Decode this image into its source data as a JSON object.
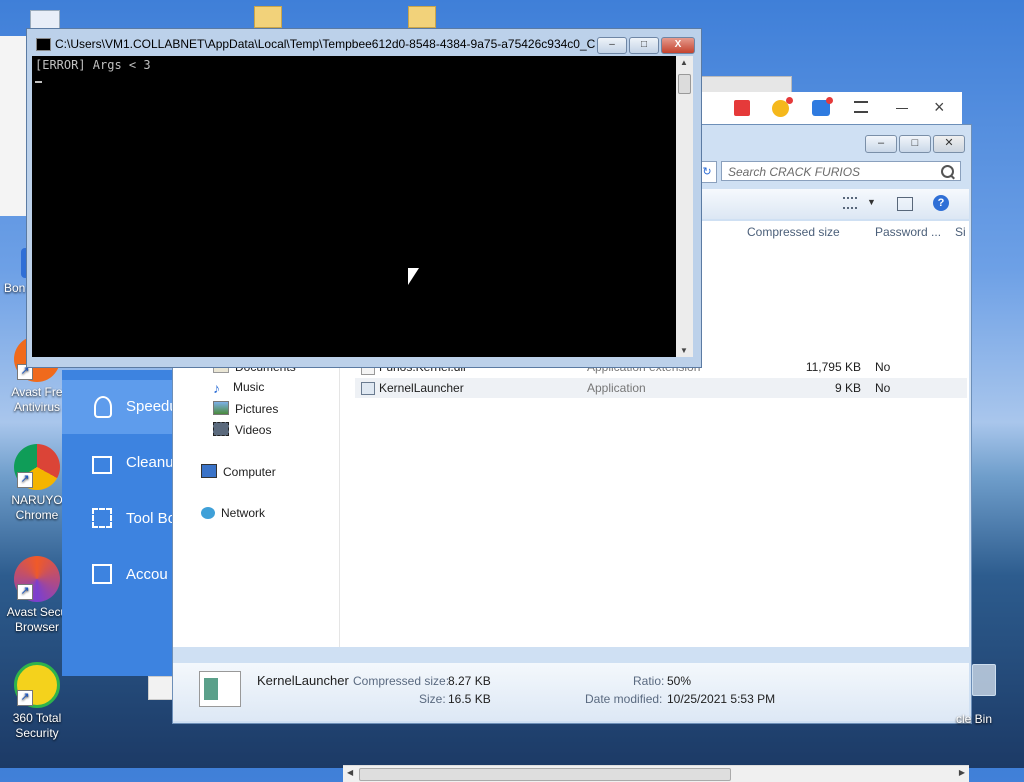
{
  "desktop_icons": [
    {
      "label": "Bon\non",
      "color": "#2f6fd6"
    },
    {
      "label": "Avast Fre\nAntivirus",
      "color": "#f06a1c"
    },
    {
      "label": "NARUYO\nChrome",
      "color": "#db4437"
    },
    {
      "label": "Avast Secu\nBrowser",
      "color": "#6a3fcf"
    },
    {
      "label": "360 Total\nSecurity",
      "color": "#2fb44b"
    }
  ],
  "recycle_bin": "cle Bin",
  "avast": {
    "items": [
      "Speedu",
      "Cleanu",
      "Tool Bo",
      "Accou"
    ]
  },
  "console": {
    "title": "C:\\Users\\VM1.COLLABNET\\AppData\\Local\\Temp\\Tempbee612d0-8548-4384-9a75-a75426c934c0_C...",
    "output": "[ERROR] Args < 3",
    "minimize": "–",
    "maximize": "□",
    "close": "X"
  },
  "explorer": {
    "search_placeholder": "Search CRACK FURIOS",
    "columns": [
      "Compressed size",
      "Password ...",
      "Si"
    ],
    "nav": [
      {
        "label": "Documents",
        "icon": "documents-icon"
      },
      {
        "label": "Music",
        "icon": "music-icon"
      },
      {
        "label": "Pictures",
        "icon": "pictures-icon"
      },
      {
        "label": "Videos",
        "icon": "videos-icon"
      },
      {
        "label": "Computer",
        "icon": "computer-icon"
      },
      {
        "label": "Network",
        "icon": "network-icon"
      }
    ],
    "files": [
      {
        "name": "Furios.Kernel.dll",
        "type": "Application extension",
        "size": "11,795 KB",
        "password": "No"
      },
      {
        "name": "KernelLauncher",
        "type": "Application",
        "size": "9 KB",
        "password": "No"
      }
    ],
    "details": {
      "name": "KernelLauncher",
      "compressed_label": "Compressed size:",
      "compressed_value": "8.27 KB",
      "size_label": "Size:",
      "size_value": "16.5 KB",
      "ratio_label": "Ratio:",
      "ratio_value": "50%",
      "modified_label": "Date modified:",
      "modified_value": "10/25/2021 5:53 PM"
    }
  }
}
